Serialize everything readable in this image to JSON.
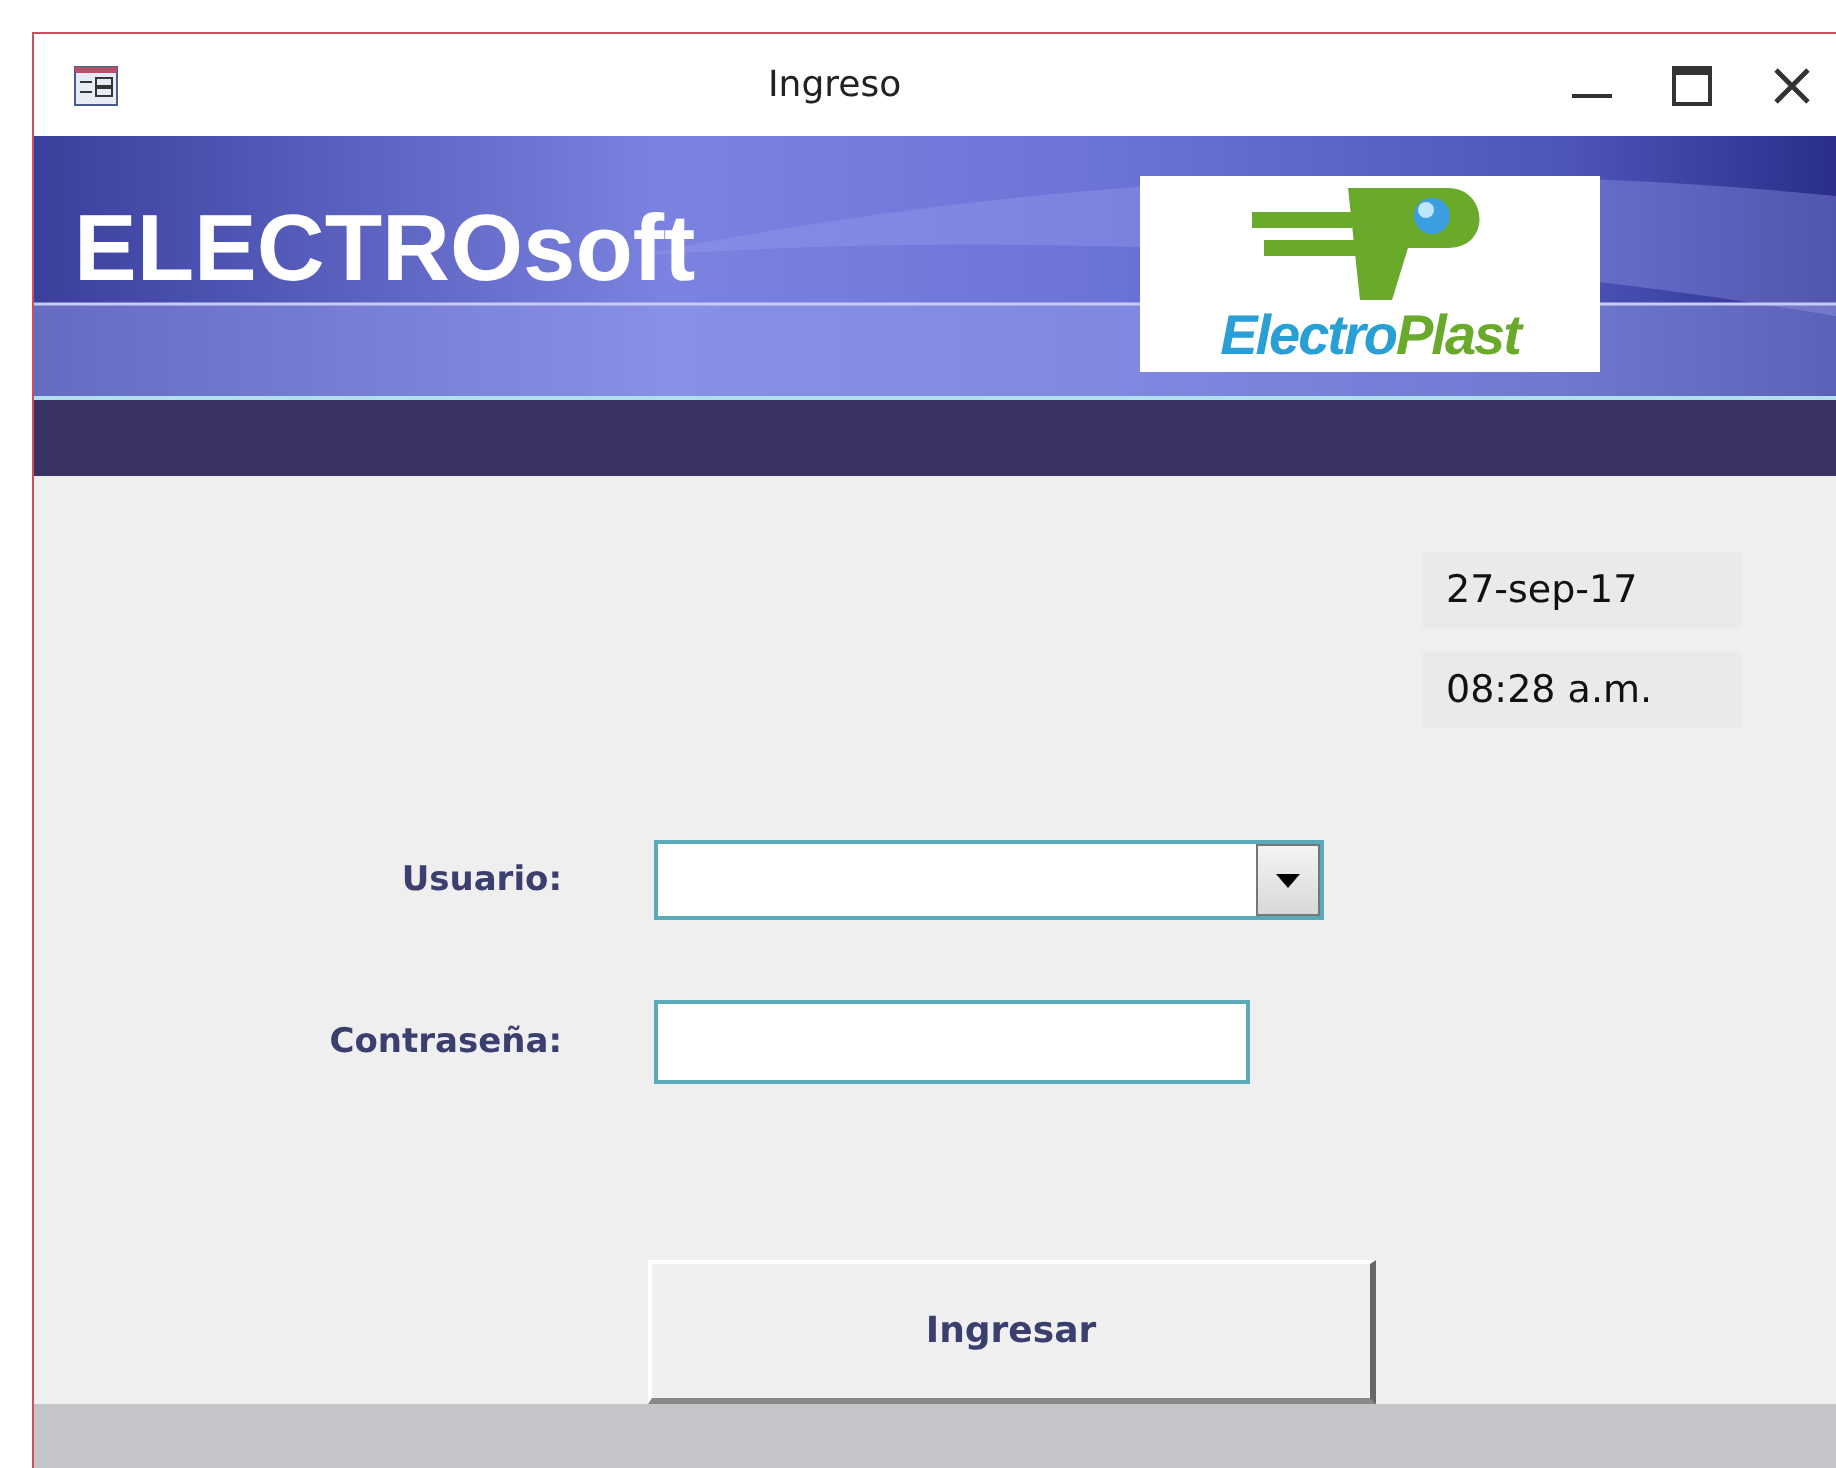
{
  "window": {
    "title": "Ingreso"
  },
  "banner": {
    "title": "ELECTROsoft",
    "logo_text_1": "Electro",
    "logo_text_2": "Plast"
  },
  "date": "27-sep-17",
  "time": "08:28 a.m.",
  "fields": [
    {
      "kind": "combo",
      "label": "Usuario:"
    },
    {
      "kind": "password",
      "label": "Contraseña:"
    }
  ],
  "button": "Ingresar"
}
